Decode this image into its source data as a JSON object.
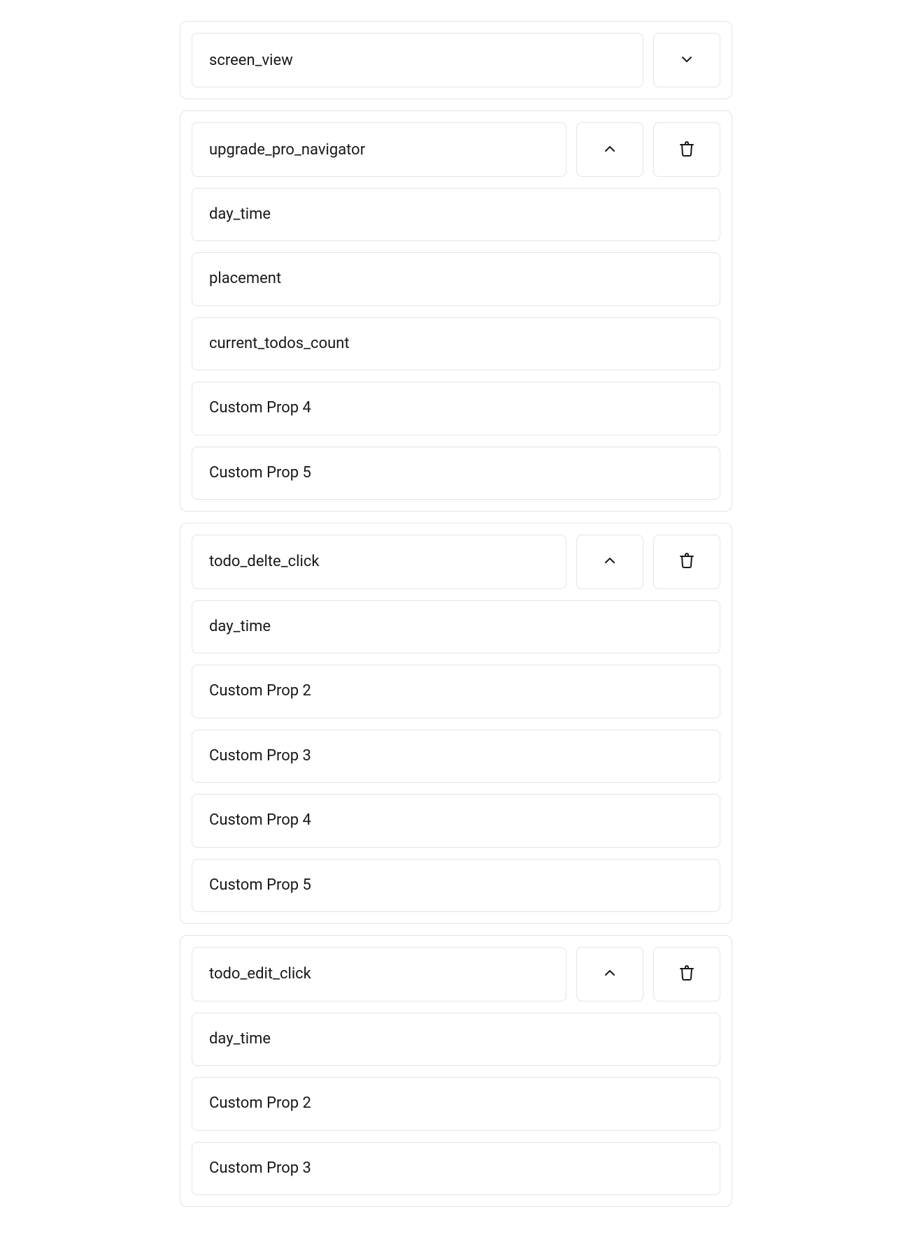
{
  "events": [
    {
      "name": "screen_view",
      "expanded": false,
      "deletable": false,
      "properties": []
    },
    {
      "name": "upgrade_pro_navigator",
      "expanded": true,
      "deletable": true,
      "properties": [
        "day_time",
        "placement",
        "current_todos_count",
        "Custom Prop 4",
        "Custom Prop 5"
      ]
    },
    {
      "name": "todo_delte_click",
      "expanded": true,
      "deletable": true,
      "properties": [
        "day_time",
        "Custom Prop 2",
        "Custom Prop 3",
        "Custom Prop 4",
        "Custom Prop 5"
      ]
    },
    {
      "name": "todo_edit_click",
      "expanded": true,
      "deletable": true,
      "properties": [
        "day_time",
        "Custom Prop 2",
        "Custom Prop 3"
      ]
    }
  ]
}
